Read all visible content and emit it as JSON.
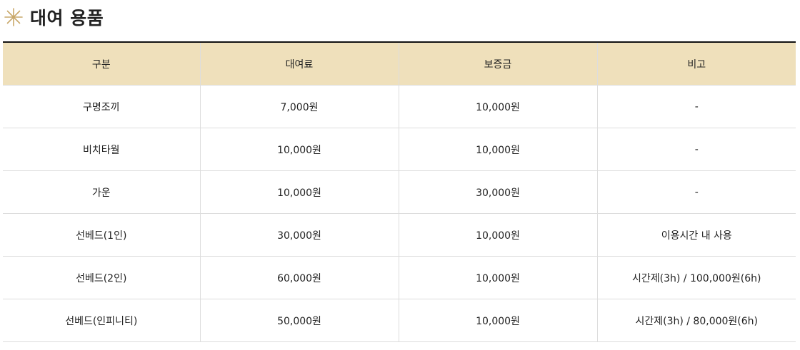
{
  "section": {
    "title": "대여 용품",
    "icon": "sparkle-icon",
    "accent_color": "#c9a86a"
  },
  "table": {
    "header_bg": "#efe0bb",
    "columns": [
      "구분",
      "대여료",
      "보증금",
      "비고"
    ],
    "rows": [
      [
        "구명조끼",
        "7,000원",
        "10,000원",
        "-"
      ],
      [
        "비치타월",
        "10,000원",
        "10,000원",
        "-"
      ],
      [
        "가운",
        "10,000원",
        "30,000원",
        "-"
      ],
      [
        "선베드(1인)",
        "30,000원",
        "10,000원",
        "이용시간 내 사용"
      ],
      [
        "선베드(2인)",
        "60,000원",
        "10,000원",
        "시간제(3h) / 100,000원(6h)"
      ],
      [
        "선베드(인피니티)",
        "50,000원",
        "10,000원",
        "시간제(3h) / 80,000원(6h)"
      ]
    ]
  }
}
